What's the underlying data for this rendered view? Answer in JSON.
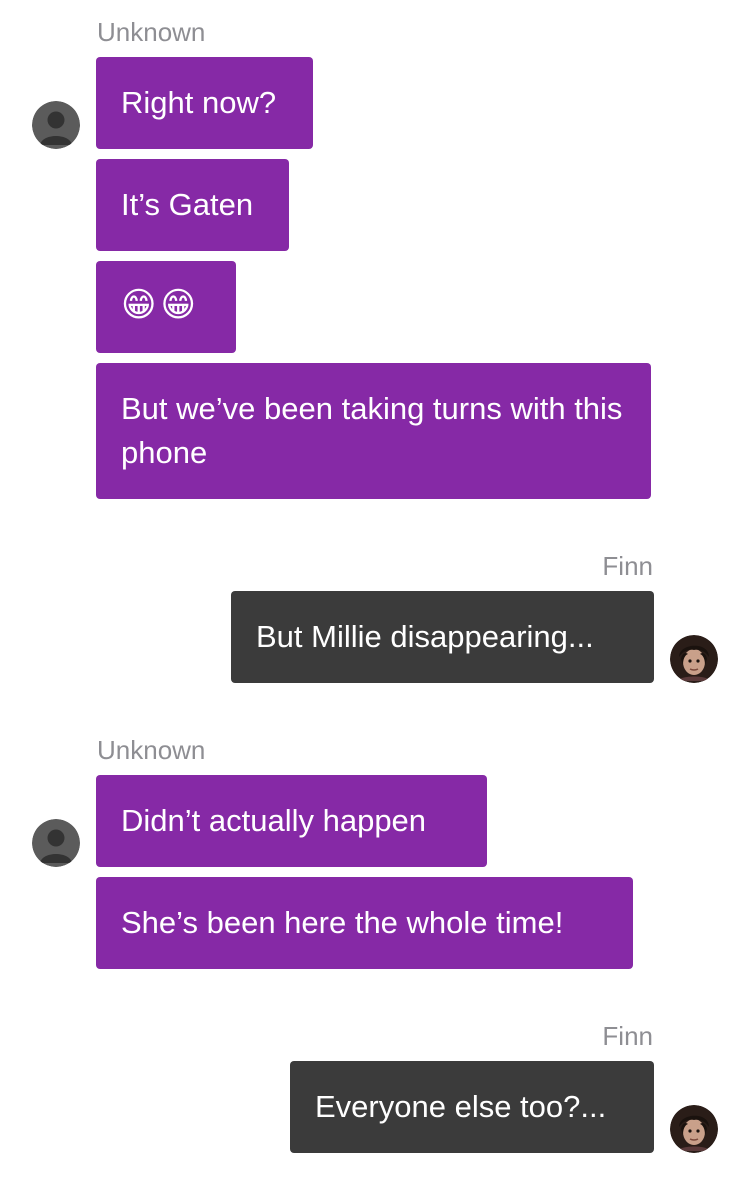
{
  "colors": {
    "incoming_bubble": "#8629a6",
    "outgoing_bubble": "#3b3b3b",
    "sender_label": "#8e8e93",
    "background": "#ffffff"
  },
  "conversation": {
    "groups": [
      {
        "sender": "Unknown",
        "direction": "incoming",
        "avatar_icon": "default-person-icon",
        "messages": [
          "Right now?",
          "It’s Gaten",
          "😁😁",
          "But we’ve been taking turns with this phone"
        ]
      },
      {
        "sender": "Finn",
        "direction": "outgoing",
        "avatar_icon": "finn-avatar-icon",
        "messages": [
          "But Millie disappearing..."
        ]
      },
      {
        "sender": "Unknown",
        "direction": "incoming",
        "avatar_icon": "default-person-icon",
        "messages": [
          "Didn’t actually happen",
          "She’s been here the whole time!"
        ]
      },
      {
        "sender": "Finn",
        "direction": "outgoing",
        "avatar_icon": "finn-avatar-icon",
        "messages": [
          "Everyone else too?..."
        ]
      }
    ]
  }
}
